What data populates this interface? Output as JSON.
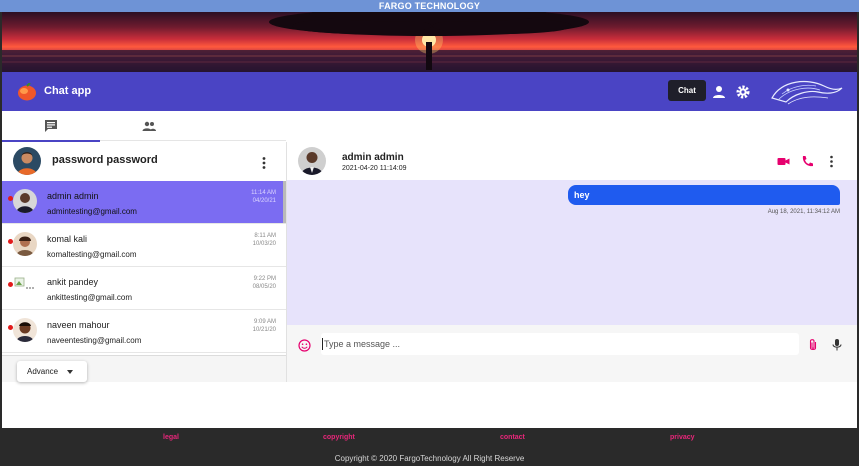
{
  "brand_strip": {
    "text": "FARGO TECHNOLOGY"
  },
  "appbar": {
    "title": "Chat app",
    "chat_chip": "Chat",
    "icons": [
      "person-icon",
      "gear-icon"
    ],
    "accent": "#4a44c4"
  },
  "tabs": [
    {
      "icon": "chat-icon",
      "active": true
    },
    {
      "icon": "people-icon",
      "active": false
    }
  ],
  "profile": {
    "name": "password password"
  },
  "contacts": [
    {
      "name": "admin admin",
      "email": "admintesting@gmail.com",
      "time": "11:14 AM",
      "date": "04/20/21",
      "active": true
    },
    {
      "name": "komal kali",
      "email": "komaltesting@gmail.com",
      "time": "8:11 AM",
      "date": "10/03/20",
      "active": false
    },
    {
      "name": "ankit pandey",
      "email": "ankittesting@gmail.com",
      "time": "9:22 PM",
      "date": "08/05/20",
      "active": false
    },
    {
      "name": "naveen mahour",
      "email": "naveentesting@gmail.com",
      "time": "9:09 AM",
      "date": "10/21/20",
      "active": false
    }
  ],
  "advance_button": {
    "label": "Advance"
  },
  "chat": {
    "name": "admin admin",
    "status": "2021-04-20 11:14:09",
    "icons": [
      "video-call-icon",
      "phone-icon",
      "more-vert-icon"
    ],
    "messages": [
      {
        "text": "hey",
        "time": "Aug 18, 2021, 11:34:12 AM",
        "outgoing": true
      }
    ],
    "input": {
      "placeholder": "Type a message ...",
      "value": ""
    }
  },
  "footer": {
    "links": [
      "legal",
      "copyright",
      "contact",
      "privacy"
    ],
    "copyright": "Copyright © 2020 FargoTechnology All Right Reserve"
  },
  "colors": {
    "active_contact": "#7b6cf2",
    "message_bubble": "#1f5bef",
    "messages_bg": "#e7e3fb",
    "footer_link": "#e8267a",
    "call_icons": "#e6006e"
  }
}
